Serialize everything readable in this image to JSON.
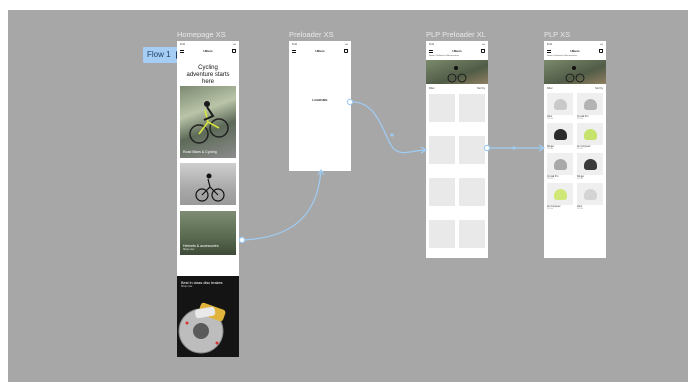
{
  "flow": {
    "label": "Flow 1"
  },
  "frames": {
    "homepage": {
      "title": "Homepage XS",
      "nav_title": "Ulbers",
      "status_time": "9:41",
      "hero": "Cycling adventure starts here",
      "cards": [
        {
          "label": "Road Bikes & Cycling",
          "sub": ""
        },
        {
          "label": "",
          "sub": ""
        },
        {
          "label": "Helmets & accessories",
          "sub": "Shop now"
        },
        {
          "label": "Best in class disc brakes",
          "sub": "Shop now"
        }
      ]
    },
    "preloader": {
      "title": "Preloader XS",
      "nav_title": "Ulbers",
      "status_time": "9:41",
      "loading": "LOADING"
    },
    "plp_preloader": {
      "title": "PLP Preloader XL",
      "nav_title": "Ulbers",
      "status_time": "9:41",
      "breadcrumb": "Home / Helmets & Accessories",
      "filter": "Filter",
      "sort": "Sort by"
    },
    "plp": {
      "title": "PLP XS",
      "nav_title": "Ulbers",
      "status_time": "9:41",
      "breadcrumb": "Home / Helmets & Accessories",
      "filter": "Filter",
      "sort": "Sort by",
      "products": [
        {
          "name": "Velor",
          "price": "€49.00",
          "color": "#c9c9c9"
        },
        {
          "name": "Crystal Pro",
          "price": "€59.00",
          "color": "#b4b4b4"
        },
        {
          "name": "Slinger",
          "price": "€45.00",
          "color": "#2c2c2c"
        },
        {
          "name": "Air Computer",
          "price": "€89.00",
          "color": "#c6e36b"
        },
        {
          "name": "Crystal Pro",
          "price": "€59.00",
          "color": "#a9a9a9"
        },
        {
          "name": "Slinger",
          "price": "€45.00",
          "color": "#3a3a3a"
        },
        {
          "name": "Air Computer",
          "price": "€89.00",
          "color": "#cfe878"
        },
        {
          "name": "Velor",
          "price": "€49.00",
          "color": "#d4d4d4"
        }
      ]
    }
  },
  "colors": {
    "canvas": "#a7a7a7",
    "connector": "#9fcdf6",
    "flow_badge": "#a6cdf3"
  }
}
